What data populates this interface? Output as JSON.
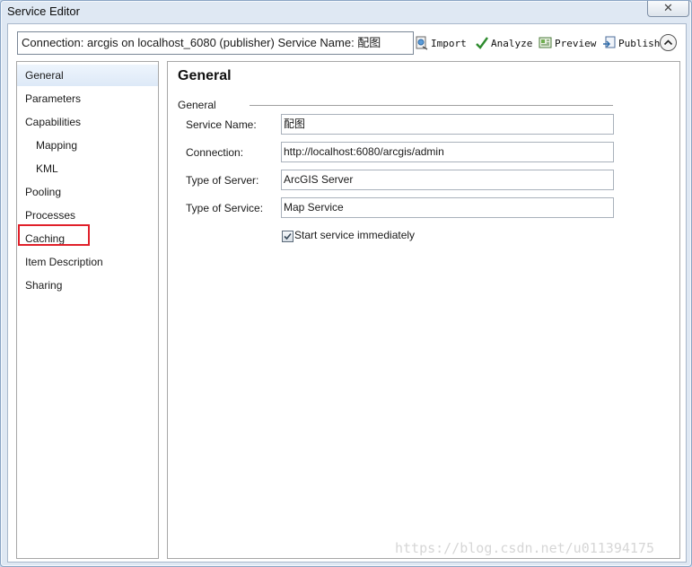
{
  "window": {
    "title": "Service Editor",
    "close_symbol": "✕"
  },
  "toolbar": {
    "connection_text": "Connection: arcgis on localhost_6080 (publisher)    Service Name: 配图",
    "import_label": "Import",
    "analyze_label": "Analyze",
    "preview_label": "Preview",
    "publish_label": "Publish",
    "icons": [
      "import-icon",
      "analyze-checkmark-icon",
      "preview-icon",
      "publish-icon",
      "collapse-chevron-up-icon"
    ]
  },
  "sidebar": {
    "items": [
      {
        "label": "General",
        "selected": true
      },
      {
        "label": "Parameters"
      },
      {
        "label": "Capabilities"
      },
      {
        "label": "Mapping",
        "sub": true
      },
      {
        "label": "KML",
        "sub": true
      },
      {
        "label": "Pooling"
      },
      {
        "label": "Processes"
      },
      {
        "label": "Caching",
        "highlighted": true
      },
      {
        "label": "Item Description"
      },
      {
        "label": "Sharing"
      }
    ]
  },
  "content": {
    "title": "General",
    "group_label": "General",
    "fields": [
      {
        "label": "Service Name:",
        "value": "配图"
      },
      {
        "label": "Connection:",
        "value": "http://localhost:6080/arcgis/admin"
      },
      {
        "label": "Type of Server:",
        "value": "ArcGIS Server"
      },
      {
        "label": "Type of Service:",
        "value": "Map Service"
      }
    ],
    "start_checkbox": {
      "label": "Start service immediately",
      "checked": true
    }
  },
  "watermark": "https://blog.csdn.net/u011394175",
  "colors": {
    "highlight_border": "#e0202a",
    "selected_item": "#dde9f7",
    "analyze_check": "#2e8b2e"
  }
}
